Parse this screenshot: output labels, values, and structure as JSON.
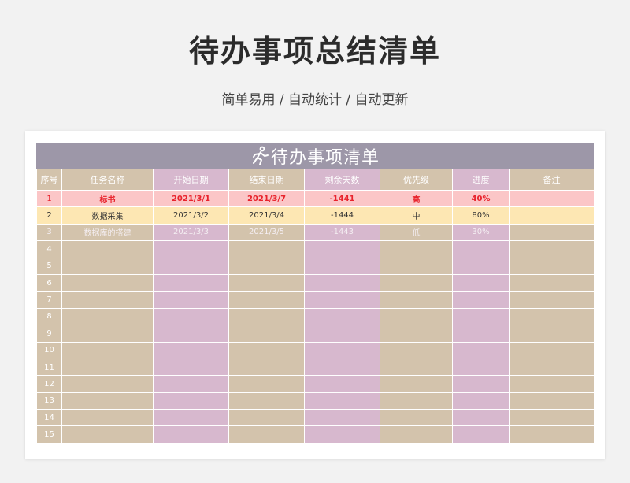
{
  "page": {
    "title": "待办事项总结清单",
    "subtitle": "简单易用 / 自动统计 / 自动更新"
  },
  "sheet": {
    "title": "待办事项清单",
    "title_icon": "running-person-icon",
    "colors": {
      "banner": "#9d97a8",
      "tan": "#d3c3ac",
      "pink": "#d7b8ce",
      "high_row": "#fbc6c7",
      "mid_row": "#fde7b3",
      "high_text": "#e8232c"
    },
    "headers": [
      "序号",
      "任务名称",
      "开始日期",
      "结束日期",
      "剩余天数",
      "优先级",
      "进度",
      "备注"
    ],
    "rows": [
      {
        "index": "1",
        "task": "标书",
        "start": "2021/3/1",
        "end": "2021/3/7",
        "remaining": "-1441",
        "priority": "高",
        "progress": "40%",
        "note": ""
      },
      {
        "index": "2",
        "task": "数据采集",
        "start": "2021/3/2",
        "end": "2021/3/4",
        "remaining": "-1444",
        "priority": "中",
        "progress": "80%",
        "note": ""
      },
      {
        "index": "3",
        "task": "数据库的搭建",
        "start": "2021/3/3",
        "end": "2021/3/5",
        "remaining": "-1443",
        "priority": "低",
        "progress": "30%",
        "note": ""
      },
      {
        "index": "4",
        "task": "",
        "start": "",
        "end": "",
        "remaining": "",
        "priority": "",
        "progress": "",
        "note": ""
      },
      {
        "index": "5",
        "task": "",
        "start": "",
        "end": "",
        "remaining": "",
        "priority": "",
        "progress": "",
        "note": ""
      },
      {
        "index": "6",
        "task": "",
        "start": "",
        "end": "",
        "remaining": "",
        "priority": "",
        "progress": "",
        "note": ""
      },
      {
        "index": "7",
        "task": "",
        "start": "",
        "end": "",
        "remaining": "",
        "priority": "",
        "progress": "",
        "note": ""
      },
      {
        "index": "8",
        "task": "",
        "start": "",
        "end": "",
        "remaining": "",
        "priority": "",
        "progress": "",
        "note": ""
      },
      {
        "index": "9",
        "task": "",
        "start": "",
        "end": "",
        "remaining": "",
        "priority": "",
        "progress": "",
        "note": ""
      },
      {
        "index": "10",
        "task": "",
        "start": "",
        "end": "",
        "remaining": "",
        "priority": "",
        "progress": "",
        "note": ""
      },
      {
        "index": "11",
        "task": "",
        "start": "",
        "end": "",
        "remaining": "",
        "priority": "",
        "progress": "",
        "note": ""
      },
      {
        "index": "12",
        "task": "",
        "start": "",
        "end": "",
        "remaining": "",
        "priority": "",
        "progress": "",
        "note": ""
      },
      {
        "index": "13",
        "task": "",
        "start": "",
        "end": "",
        "remaining": "",
        "priority": "",
        "progress": "",
        "note": ""
      },
      {
        "index": "14",
        "task": "",
        "start": "",
        "end": "",
        "remaining": "",
        "priority": "",
        "progress": "",
        "note": ""
      },
      {
        "index": "15",
        "task": "",
        "start": "",
        "end": "",
        "remaining": "",
        "priority": "",
        "progress": "",
        "note": ""
      }
    ]
  }
}
